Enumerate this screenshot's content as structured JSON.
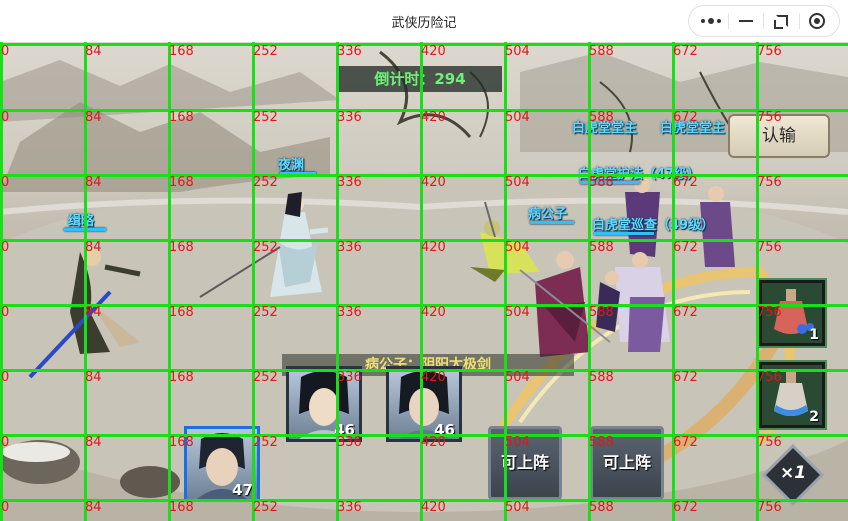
{
  "window": {
    "title": "武侠历险记",
    "controls": [
      "more-icon",
      "minimize-icon",
      "restore-icon",
      "close-target-icon"
    ]
  },
  "hud": {
    "countdown_label": "倒计时：",
    "countdown_value": "294",
    "surrender_label": "认输"
  },
  "units": {
    "ally_1": "缉略",
    "ally_2": "夜渊",
    "enemy_1": "病公子",
    "enemy_2": "白虎堂堂主",
    "enemy_3": "白虎堂堂主",
    "enemy_4": "白虎堂护法（47级）",
    "enemy_5": "白虎堂巡查（49级）"
  },
  "skill_banner": "病公子：阴阳太极剑",
  "hero_cards": [
    {
      "level": "47"
    },
    {
      "level": "46"
    },
    {
      "level": "46"
    }
  ],
  "empty_slots": [
    "可上阵",
    "可上阵"
  ],
  "items": [
    {
      "icon": "red-potion-icon",
      "count": "1"
    },
    {
      "icon": "blue-potion-icon",
      "count": "2"
    }
  ],
  "speed_label": "×1",
  "grid": {
    "x_labels": [
      "0",
      "84",
      "168",
      "252",
      "336",
      "420",
      "504",
      "588",
      "672",
      "756"
    ],
    "y_labels": [
      "0",
      "84",
      "168",
      "252",
      "336",
      "420",
      "504",
      "588",
      "672",
      "756"
    ]
  },
  "colors": {
    "grid_line": "#18e018",
    "grid_label": "#e01818",
    "name_text": "#62d8ff",
    "timer_text": "#6ff07a"
  }
}
